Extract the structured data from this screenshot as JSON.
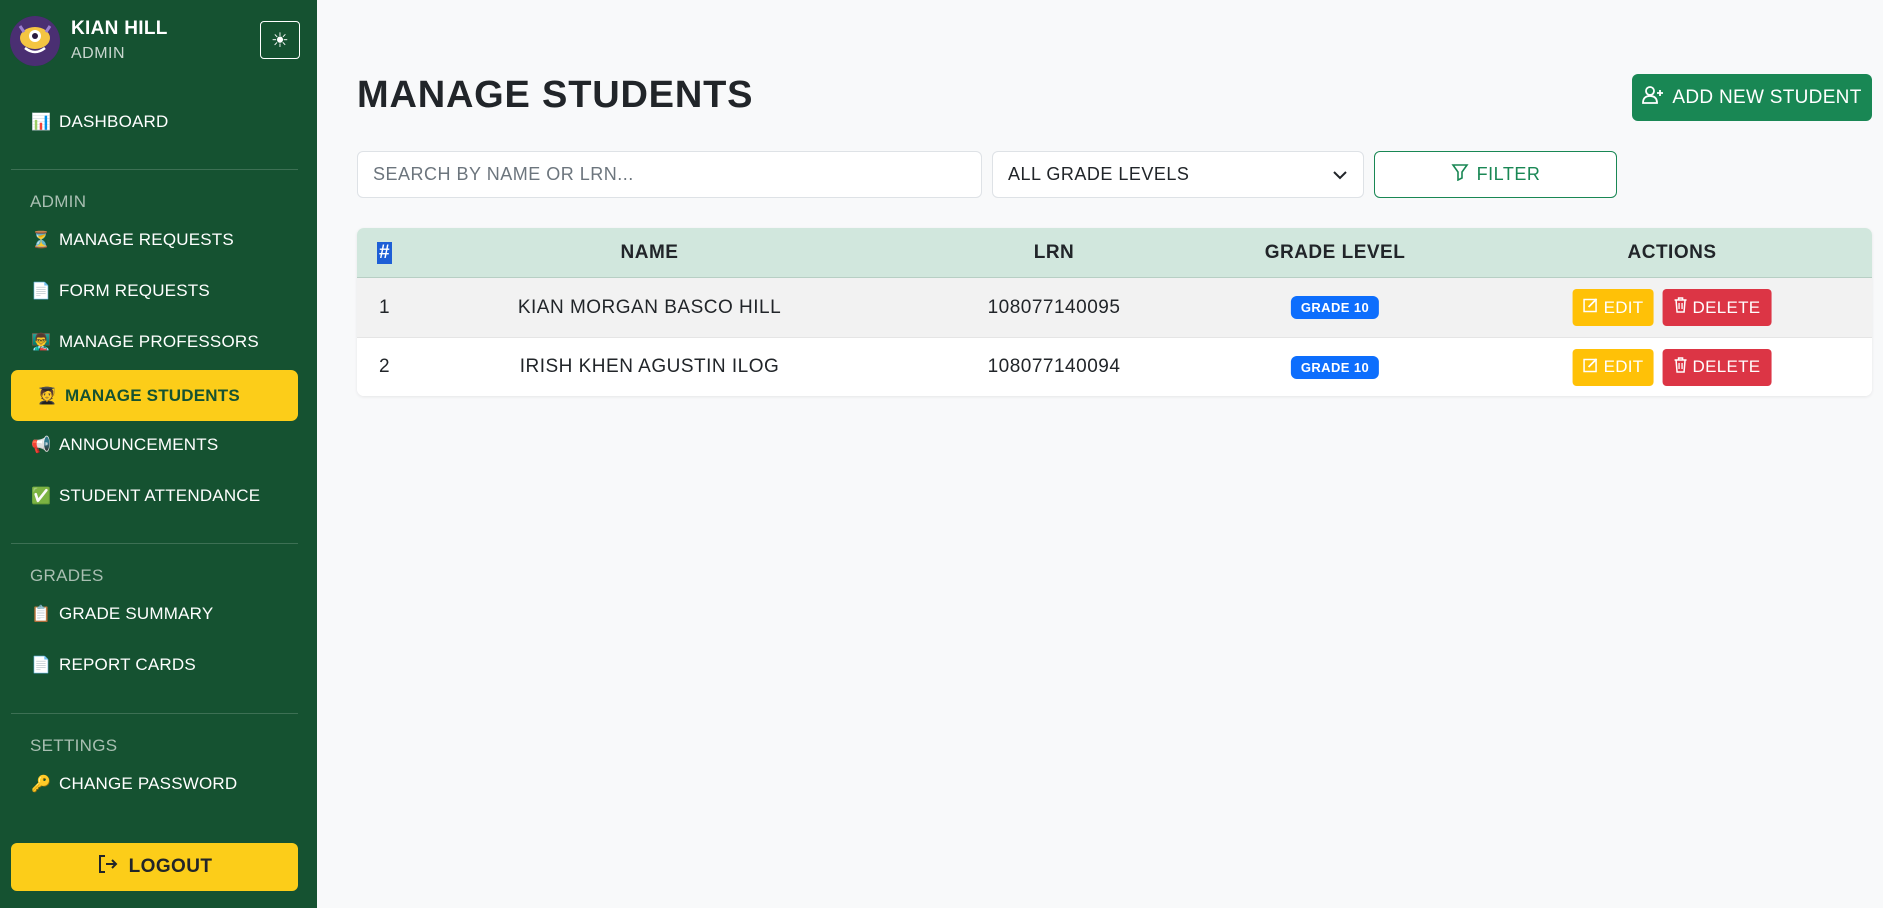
{
  "user": {
    "name": "KIAN HILL",
    "role": "ADMIN"
  },
  "sidebar": {
    "dashboard": {
      "emoji": "📊",
      "label": "DASHBOARD"
    },
    "sections": [
      {
        "label": "ADMIN"
      },
      {
        "label": "GRADES"
      },
      {
        "label": "SETTINGS"
      }
    ],
    "items": [
      {
        "emoji": "⏳",
        "label": "MANAGE REQUESTS"
      },
      {
        "emoji": "📄",
        "label": "FORM REQUESTS"
      },
      {
        "emoji": "👨‍🏫",
        "label": "MANAGE PROFESSORS"
      },
      {
        "emoji": "🧑‍🎓",
        "label": "MANAGE STUDENTS",
        "active": true
      },
      {
        "emoji": "📢",
        "label": "ANNOUNCEMENTS"
      },
      {
        "emoji": "✅",
        "label": "STUDENT ATTENDANCE"
      },
      {
        "emoji": "📋",
        "label": "GRADE SUMMARY"
      },
      {
        "emoji": "📄",
        "label": "REPORT CARDS"
      },
      {
        "emoji": "🔑",
        "label": "CHANGE PASSWORD"
      }
    ],
    "logout_label": "LOGOUT",
    "theme_icon": "☀"
  },
  "main": {
    "title": "MANAGE STUDENTS",
    "add_label": "ADD NEW STUDENT",
    "search_placeholder": "SEARCH BY NAME OR LRN...",
    "grade_select": "ALL GRADE LEVELS",
    "filter_label": "FILTER"
  },
  "table": {
    "headers": [
      "#",
      "NAME",
      "LRN",
      "GRADE LEVEL",
      "ACTIONS"
    ],
    "rows": [
      {
        "num": "1",
        "name": "KIAN MORGAN BASCO HILL",
        "lrn": "108077140095",
        "grade": "GRADE 10"
      },
      {
        "num": "2",
        "name": "IRISH KHEN AGUSTIN ILOG",
        "lrn": "108077140094",
        "grade": "GRADE 10"
      }
    ],
    "edit_label": "EDIT",
    "delete_label": "DELETE"
  },
  "colors": {
    "sidebar_bg": "#155231",
    "accent_yellow": "#fccd19",
    "primary_green": "#198754",
    "header_bg": "#d1e7dd",
    "badge_blue": "#0d6efd",
    "edit_yellow": "#ffc107",
    "delete_red": "#dc3545"
  }
}
